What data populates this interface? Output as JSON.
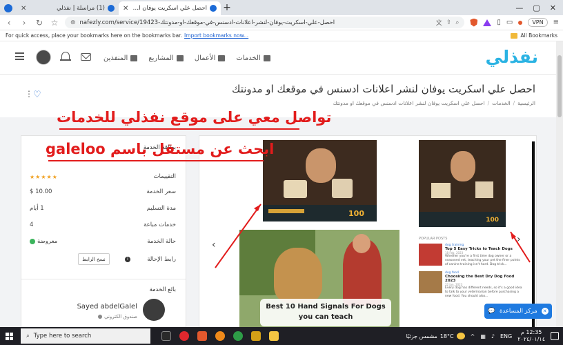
{
  "browser": {
    "tabs": [
      {
        "title": "(1) مراسلة | نفذلي",
        "active": false
      },
      {
        "title": "احصل علي اسكريت يوفان لنشر اعلا",
        "active": true
      }
    ],
    "new_tab": "+",
    "url": "nafezly.com/service/19423-احصل-علي-اسكريت-يوفان-لنشر-اعلانات-ادسنس-في-موقعك-او-مدونتك",
    "vpn": "VPN",
    "bookmarks_hint": "For quick access, place your bookmarks here on the bookmarks bar.",
    "import_link": "Import bookmarks now...",
    "all_bookmarks": "All Bookmarks"
  },
  "site": {
    "logo": "نفذلي",
    "nav": [
      {
        "label": "الخدمات"
      },
      {
        "label": "الأعمال"
      },
      {
        "label": "المشاريع"
      },
      {
        "label": "المنفذين"
      }
    ],
    "page_title": "احصل علي اسكريت يوفان لنشر اعلانات ادسنس في موقعك او مدونتك",
    "breadcrumb": [
      "الرئيسية",
      "الخدمات",
      "احصل علي اسكريت يوفان لنشر اعلانات ادسنس في موقعك او مدونتك"
    ]
  },
  "card": {
    "title": "بطاقة الخدمة",
    "rows": [
      {
        "label": "التقييمات",
        "value": "★★★★★"
      },
      {
        "label": "سعر الخدمة",
        "value": "10.00 $"
      },
      {
        "label": "مدة التسليم",
        "value": "1 أيام"
      },
      {
        "label": "خدمات مباعة",
        "value": "4"
      },
      {
        "label": "حالة الخدمة",
        "value": "معروضة"
      },
      {
        "label": "رابط الإحالة",
        "value": ""
      }
    ],
    "copy_button": "نسخ الرابط",
    "seller_title": "بائع الخدمة",
    "seller_name": "Sayed abdelGalel",
    "seller_sub": "صندوق الكتروني"
  },
  "gallery": {
    "caption": "Best 10 Hand Signals For Dogs you can teach",
    "popular": "POPULAR POSTS",
    "posts": [
      {
        "cat": "dog training",
        "title": "Top 5 Easy Tricks to Teach Dogs",
        "date": "18 Feb, 2023",
        "excerpt": "Whether you're a first time dog owner or a seasoned vet, teaching your pet the finer points of canine training isn't hard. Dog trick..."
      },
      {
        "cat": "dog food",
        "title": "Choosing the Best Dry Dog Food 2023",
        "date": "22 Jan, 2023",
        "excerpt": "Every dog has different needs, so it's a good idea to talk to your veterinarian before purchasing a new food. You should also..."
      }
    ],
    "brand": "100"
  },
  "overlay": {
    "line1": "تواصل معي على موقع نفذلي للخدمات",
    "line2": "ابحث عن مستقل باسم galeloo"
  },
  "help": {
    "label": "مركز المساعدة"
  },
  "taskbar": {
    "search_placeholder": "Type here to search",
    "weather": "مشمس جزئيًا",
    "temp": "18°C",
    "time": "12:35 م",
    "date": "٢٠٢٤/٠١/١٤",
    "lang": "ENG"
  }
}
